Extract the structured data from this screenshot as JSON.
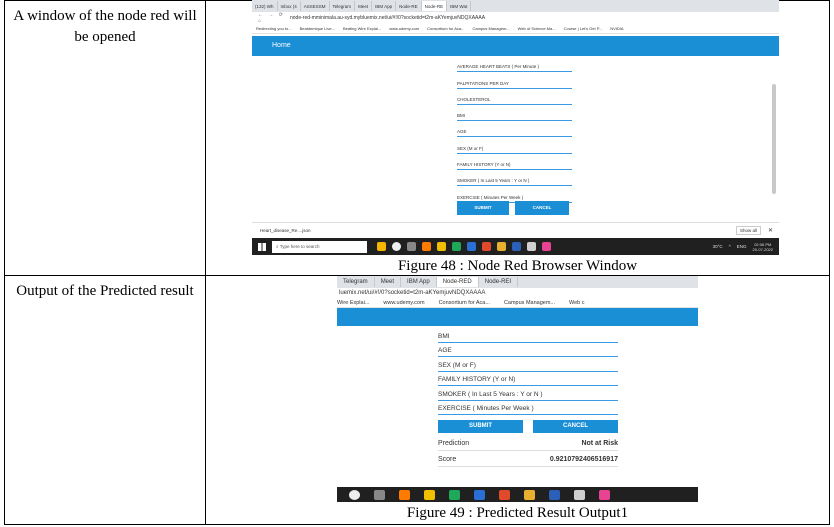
{
  "rows": [
    {
      "label": "A window of the node red will be opened",
      "caption": "Figure 48 : Node Red Browser Window"
    },
    {
      "label": "Output of the Predicted result",
      "caption": "Figure 49 : Predicted Result Output1"
    }
  ],
  "shot1": {
    "tabs": [
      "(132) Wh",
      "Inbox (4",
      "ASSESSM",
      "Telegram",
      "Meet",
      "IBM App",
      "Node-RE",
      "Node-RE",
      "IBM Wat"
    ],
    "nav": "← → ⟳ ⌂",
    "url": "node-red-mminimala.au-syd.mybluemix.net/ui/#!/0?socketid=t2m-aKYemjuvNDQXAAAA",
    "bookmarks": [
      "Redirecting you to...",
      "Beatdemique Live...",
      "Beating Wire Explai...",
      "www.udemy.com",
      "Consortium for Aca...",
      "Campus Managem...",
      "Web of Science Ma...",
      "Course | Let's Get P...",
      "NVIDIA"
    ],
    "header": "Home",
    "fields": [
      "AVERAGE HEART BEATS ( Per Minute )",
      "PALPITATIONS PER DAY",
      "CHOLESTEROL",
      "BMI",
      "AGE",
      "SEX (M or F)",
      "FAMILY HISTORY (Y or N)",
      "SMOKER ( In Last 5 Years : Y or N )",
      "EXERCISE ( Minutes Per Week )"
    ],
    "submit": "SUBMIT",
    "cancel": "CANCEL",
    "download": "Heart_disease_Re....json",
    "show_all": "Show all",
    "search": "Type here to search",
    "temp": "30°C",
    "lang": "ENG",
    "time": "02:06 PM",
    "date": "20-07-2022"
  },
  "shot2": {
    "tabs": [
      "Telegram",
      "Meet",
      "IBM App",
      "Node-RED",
      "Node-REI"
    ],
    "url": "luemix.net/ui/#!/0?socketid=t2m-aKYemjuvNDQXAAAA",
    "bookmarks": [
      "Wire Explai...",
      "www.udemy.com",
      "Consortium for Aca...",
      "Campus Managem...",
      "Web c"
    ],
    "fields": [
      "BMI",
      "AGE",
      "SEX (M or F)",
      "FAMILY HISTORY (Y or N)",
      "SMOKER ( In Last 5 Years : Y or N )",
      "EXERCISE ( Minutes Per Week )"
    ],
    "submit": "SUBMIT",
    "cancel": "CANCEL",
    "prediction_label": "Prediction",
    "prediction_value": "Not at Risk",
    "score_label": "Score",
    "score_value": "0.9210792406516917"
  },
  "colors": {
    "accent": "#1a8fd6",
    "taskbar": "#202020"
  }
}
